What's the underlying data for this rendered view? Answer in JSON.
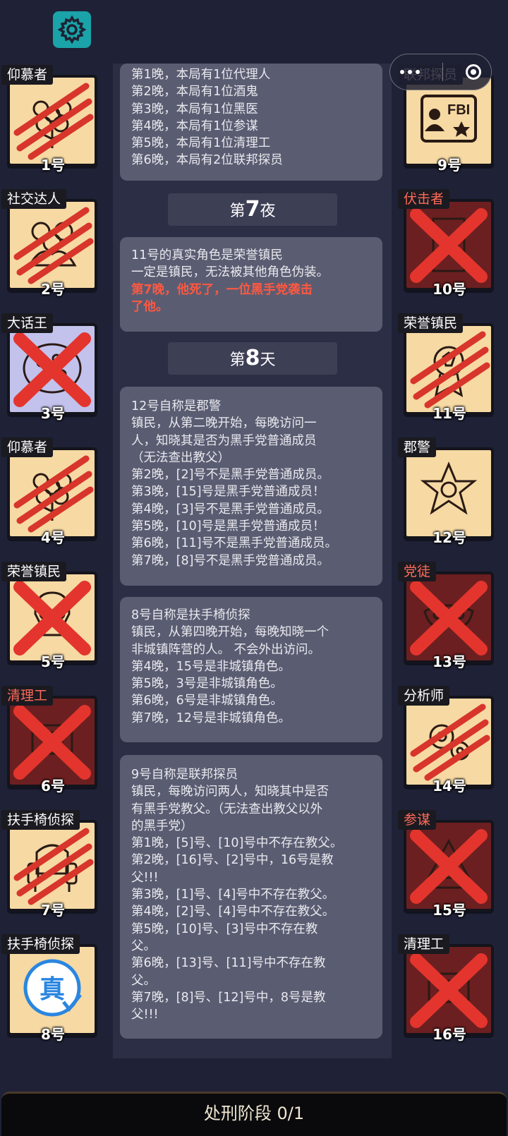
{
  "top": {
    "settings_icon": "gear-icon"
  },
  "capsule": {
    "menu_icon": "more-dots-icon",
    "close_icon": "target-circle-icon"
  },
  "players_left": [
    {
      "role": "仰慕者",
      "number": "1号",
      "status": "claw",
      "art": "flower-icon",
      "role_color": "white"
    },
    {
      "role": "社交达人",
      "number": "2号",
      "status": "claw",
      "art": "people-icon",
      "role_color": "white"
    },
    {
      "role": "大话王",
      "number": "3号",
      "status": "cross",
      "art": "pizza-icon",
      "role_color": "white"
    },
    {
      "role": "仰慕者",
      "number": "4号",
      "status": "claw",
      "art": "flower-icon",
      "role_color": "white"
    },
    {
      "role": "荣誉镇民",
      "number": "5号",
      "status": "cross",
      "art": "skull-icon",
      "role_color": "white"
    },
    {
      "role": "清理工",
      "number": "6号",
      "status": "cross",
      "art": "machine-icon",
      "role_color": "red"
    },
    {
      "role": "扶手椅侦探",
      "number": "7号",
      "status": "claw",
      "art": "armchair-icon",
      "role_color": "white"
    },
    {
      "role": "扶手椅侦探",
      "number": "8号",
      "status": "verified",
      "art": "verified-badge-icon",
      "role_color": "white",
      "badge": "真"
    }
  ],
  "players_right": [
    {
      "role": "联邦探员",
      "number": "9号",
      "status": "alive",
      "art": "fbi-badge-icon",
      "role_color": "white",
      "badge": "FBI"
    },
    {
      "role": "伏击者",
      "number": "10号",
      "status": "cross",
      "art": "door-icon",
      "role_color": "red"
    },
    {
      "role": "荣誉镇民",
      "number": "11号",
      "status": "claw",
      "art": "medal-icon",
      "role_color": "white"
    },
    {
      "role": "郡警",
      "number": "12号",
      "status": "alive",
      "art": "sheriff-star-icon",
      "role_color": "white"
    },
    {
      "role": "党徒",
      "number": "13号",
      "status": "cross",
      "art": "mask-icon",
      "role_color": "red"
    },
    {
      "role": "分析师",
      "number": "14号",
      "status": "claw",
      "art": "gears-icon",
      "role_color": "white"
    },
    {
      "role": "参谋",
      "number": "15号",
      "status": "cross",
      "art": "triangle-icon",
      "role_color": "red"
    },
    {
      "role": "清理工",
      "number": "16号",
      "status": "cross",
      "art": "machine-icon",
      "role_color": "white"
    }
  ],
  "log": {
    "bubble1": [
      "第1晚，本局有1位代理人",
      "第2晚，本局有1位酒鬼",
      "第3晚，本局有1位黑医",
      "第4晚，本局有1位参谋",
      "第5晚，本局有1位清理工",
      "第6晚，本局有2位联邦探员"
    ],
    "night7_header": {
      "prefix": "第",
      "num": "7",
      "suffix": "夜"
    },
    "bubble2": [
      "11号的真实角色是荣誉镇民",
      "一定是镇民，无法被其他角色伪装。"
    ],
    "bubble2_red": [
      "第7晚，他死了，一位黑手党袭击",
      "了他。"
    ],
    "day8_header": {
      "prefix": "第",
      "num": "8",
      "suffix": "天"
    },
    "bubble3": [
      "12号自称是郡警",
      "镇民，从第二晚开始，每晚访问一",
      "人，知晓其是否为黑手党普通成员",
      "（无法查出教父）",
      "第2晚，[2]号不是黑手党普通成员。",
      "第3晚，[15]号是黑手党普通成员！",
      "第4晚，[3]号不是黑手党普通成员。",
      "第5晚，[10]号是黑手党普通成员！",
      "第6晚，[11]号不是黑手党普通成员。",
      "第7晚，[8]号不是黑手党普通成员。"
    ],
    "bubble4": [
      "8号自称是扶手椅侦探",
      "镇民，从第四晚开始，每晚知晓一个",
      "非城镇阵营的人。 不会外出访问。",
      "第4晚，15号是非城镇角色。",
      "第5晚，3号是非城镇角色。",
      "第6晚，6号是非城镇角色。",
      "第7晚，12号是非城镇角色。"
    ],
    "bubble5": [
      "9号自称是联邦探员",
      "镇民，每晚访问两人，知晓其中是否",
      "有黑手党教父。（无法查出教父以外",
      "的黑手党）",
      "第1晚，[5]号、[10]号中不存在教父。",
      "第2晚，[16]号、[2]号中，16号是教",
      "父!!!",
      "第3晚，[1]号、[4]号中不存在教父。",
      "第4晚，[2]号、[4]号中不存在教父。",
      "第5晚，[10]号、[3]号中不存在教",
      "父。",
      "第6晚，[13]号、[11]号中不存在教",
      "父。",
      "第7晚，[8]号、[12]号中，8号是教",
      "父!!!"
    ]
  },
  "bottom": {
    "phase_label": "处刑阶段 0/1"
  },
  "colors": {
    "background": "#1f2136",
    "card": "#f6d9a3",
    "dead_card": "#6c1f20",
    "cross": "#e3352d",
    "accent_red": "#ff5840",
    "settings": "#1aa3a8"
  }
}
